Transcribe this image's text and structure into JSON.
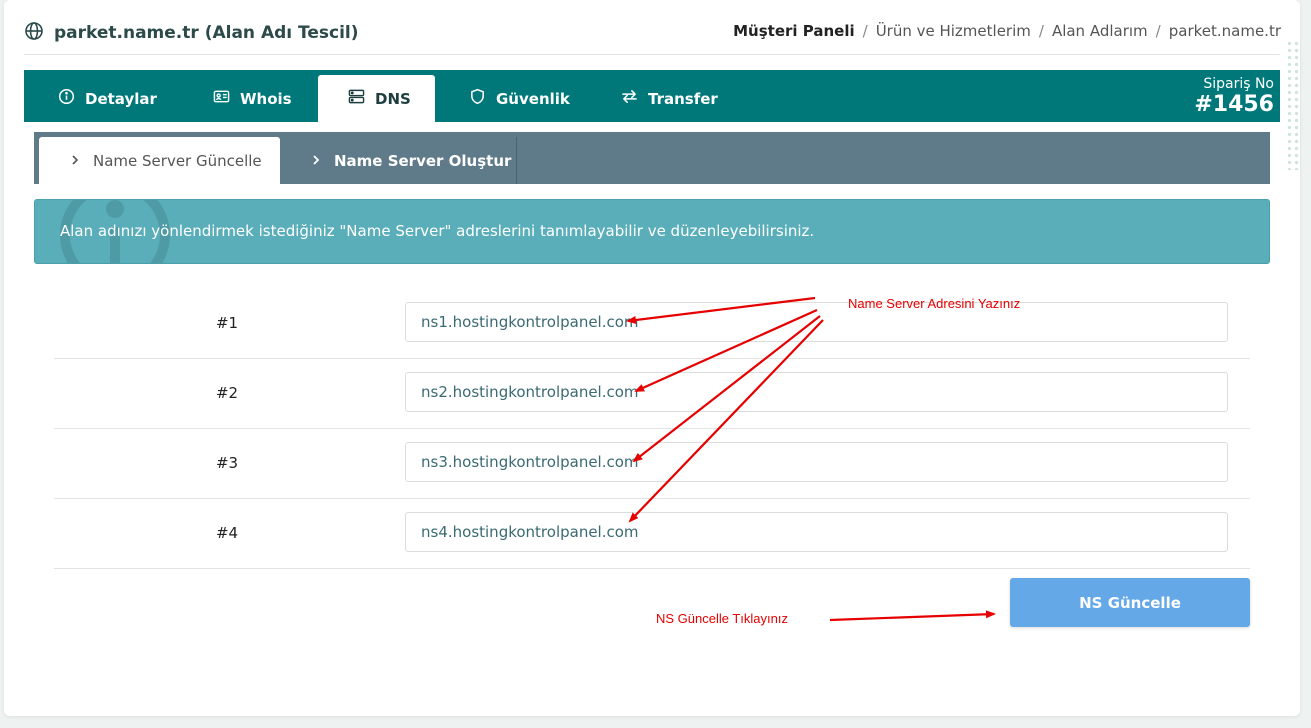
{
  "header": {
    "title": "parket.name.tr (Alan Adı Tescil)",
    "title_icon": "globe-icon",
    "breadcrumb": [
      "Müşteri Paneli",
      "Ürün ve Hizmetlerim",
      "Alan Adlarım",
      "parket.name.tr"
    ],
    "breadcrumb_separator": "/"
  },
  "tabs": [
    {
      "label": "Detaylar",
      "icon": "info-icon"
    },
    {
      "label": "Whois",
      "icon": "id-card-icon"
    },
    {
      "label": "DNS",
      "icon": "server-icon",
      "active": true
    },
    {
      "label": "Güvenlik",
      "icon": "shield-icon"
    },
    {
      "label": "Transfer",
      "icon": "transfer-icon"
    }
  ],
  "order": {
    "label": "Sipariş No",
    "number": "#1456"
  },
  "subtabs": [
    {
      "label": "Name Server Güncelle",
      "active": true
    },
    {
      "label": "Name Server Oluştur",
      "active": false
    }
  ],
  "alert": {
    "text": "Alan adınızı yönlendirmek istediğiniz \"Name Server\" adreslerini tanımlayabilir ve düzenleyebilirsiniz."
  },
  "nameservers": [
    {
      "label": "#1",
      "value": "ns1.hostingkontrolpanel.com"
    },
    {
      "label": "#2",
      "value": "ns2.hostingkontrolpanel.com"
    },
    {
      "label": "#3",
      "value": "ns3.hostingkontrolpanel.com"
    },
    {
      "label": "#4",
      "value": "ns4.hostingkontrolpanel.com"
    }
  ],
  "submit_label": "NS Güncelle",
  "annotations": {
    "ns_hint": "Name Server Adresini Yazınız",
    "button_hint": "NS Güncelle Tıklayınız"
  },
  "colors": {
    "tabbar": "#00787a",
    "subbar": "#5f7a88",
    "alert": "#5aaeb9",
    "button": "#64a8e8",
    "annotation": "#e60000"
  }
}
